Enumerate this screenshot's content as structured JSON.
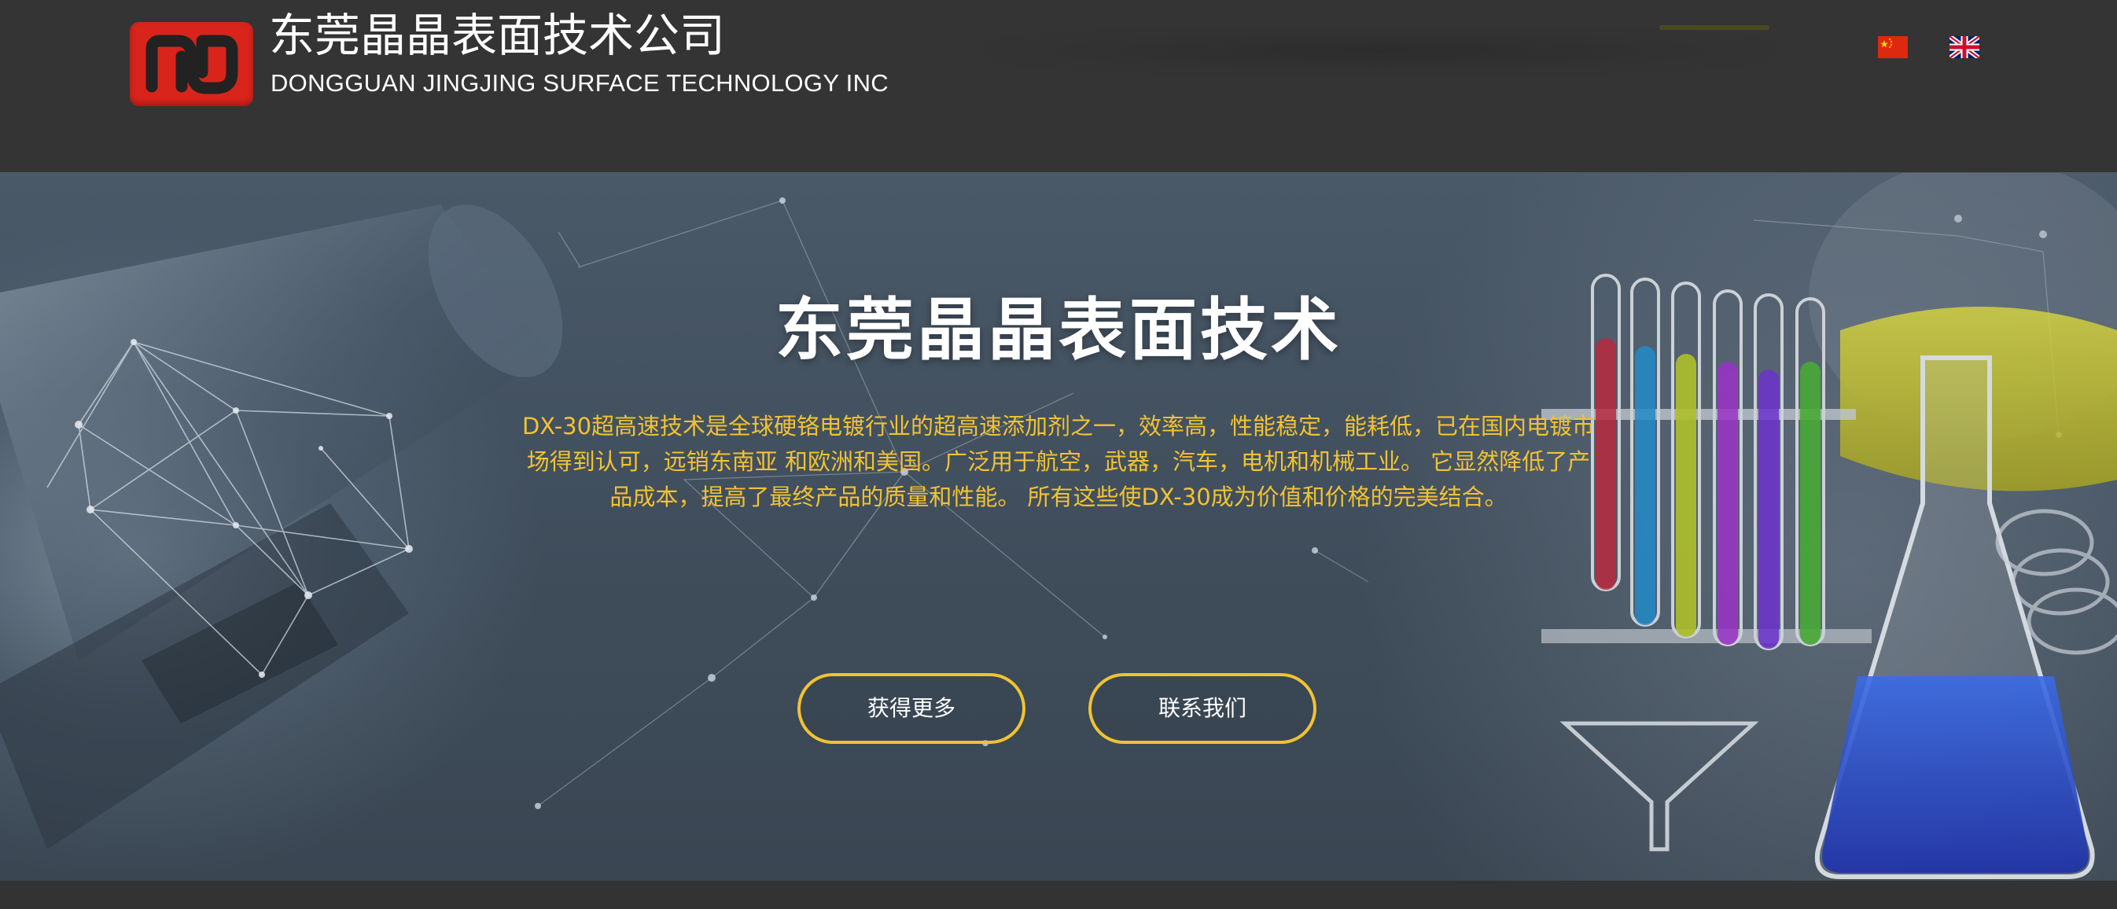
{
  "header": {
    "brand_cn": "东莞晶晶表面技术公司",
    "brand_en": "DONGGUAN JINGJING SURFACE TECHNOLOGY INC",
    "languages": [
      {
        "code": "zh",
        "icon": "china-flag-icon"
      },
      {
        "code": "en",
        "icon": "uk-flag-icon"
      }
    ]
  },
  "hero": {
    "title": "东莞晶晶表面技术",
    "description": "DX-30超高速技术是全球硬铬电镀行业的超高速添加剂之一，效率高，性能稳定，能耗低，已在国内电镀市场得到认可，远销东南亚 和欧洲和美国。广泛用于航空，武器，汽车，电机和机械工业。 它显然降低了产品成本，提高了最终产品的质量和性能。 所有这些使DX-30成为价值和价格的完美结合。",
    "buttons": {
      "learn_more": "获得更多",
      "contact_us": "联系我们"
    }
  },
  "colors": {
    "header_bg": "#343434",
    "accent_yellow": "#f1c232",
    "logo_red": "#d9241c",
    "hero_bg": "#44525f"
  }
}
